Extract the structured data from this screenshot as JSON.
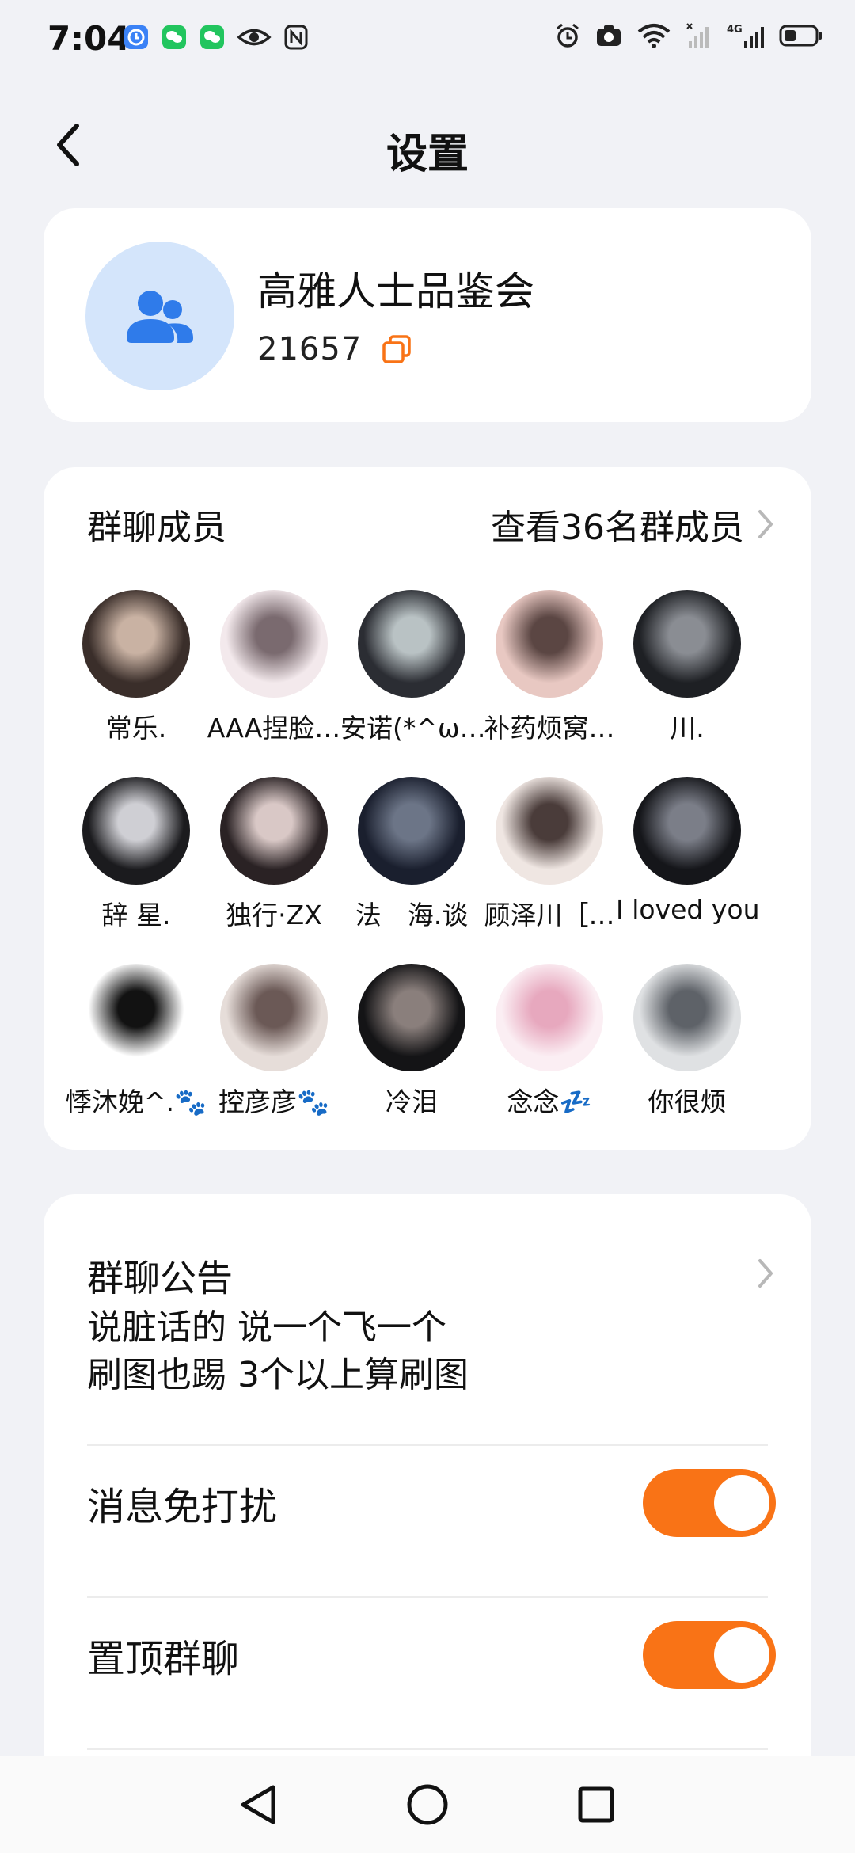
{
  "status": {
    "time": "7:04",
    "left_icons": [
      "clock-app-icon",
      "wechat-icon",
      "wechat-icon",
      "eye-icon",
      "nfc-icon"
    ],
    "right_icons": [
      "alarm-icon",
      "camera-icon",
      "wifi-icon",
      "signal-icon",
      "4g-signal-icon",
      "battery-icon"
    ],
    "network": "4G"
  },
  "header": {
    "title": "设置"
  },
  "group": {
    "name": "高雅人士品鉴会",
    "id": "21657"
  },
  "members": {
    "title": "群聊成员",
    "view_all": "查看36名群成员",
    "list": [
      {
        "name": "常乐.",
        "color1": "#3a2e2a",
        "color2": "#c9b2a3"
      },
      {
        "name": "AAA捏脸…",
        "color1": "#f3e9ec",
        "color2": "#7a6a6f"
      },
      {
        "name": "安诺(*^ω…",
        "color1": "#2b2d33",
        "color2": "#b9c2c4"
      },
      {
        "name": "补药烦窝…",
        "color1": "#e8c8c2",
        "color2": "#5b4643"
      },
      {
        "name": "川.",
        "color1": "#1e2024",
        "color2": "#8a8d93"
      },
      {
        "name": "辞 星.",
        "color1": "#1b1b1e",
        "color2": "#cfcfd4"
      },
      {
        "name": "独行·ZX",
        "color1": "#2a2224",
        "color2": "#d9c8c6"
      },
      {
        "name": "法　海.谈",
        "color1": "#1a1f2e",
        "color2": "#6c7587"
      },
      {
        "name": "顾泽川［…",
        "color1": "#efe6e2",
        "color2": "#4a3c3a"
      },
      {
        "name": "I loved you",
        "color1": "#15161a",
        "color2": "#7b7e88"
      },
      {
        "name": "悸沐娩^.🐾",
        "color1": "#ffffff",
        "color2": "#121212"
      },
      {
        "name": "控彦彦🐾",
        "color1": "#e6ddd9",
        "color2": "#6b5956"
      },
      {
        "name": "冷泪",
        "color1": "#141416",
        "color2": "#8a7f7c"
      },
      {
        "name": "念念💤",
        "color1": "#fbeef3",
        "color2": "#e7a8be"
      },
      {
        "name": "你很烦",
        "color1": "#dfe1e3",
        "color2": "#5e6268"
      }
    ]
  },
  "notice": {
    "title": "群聊公告",
    "lines": [
      "说脏话的 说一个飞一个",
      "刷图也踢 3个以上算刷图"
    ]
  },
  "settings": [
    {
      "label": "消息免打扰",
      "on": true
    },
    {
      "label": "置顶群聊",
      "on": true
    }
  ],
  "colors": {
    "accent": "#f97316",
    "background": "#f1f2f6",
    "card": "#ffffff",
    "group_avatar_bg": "#d4e5fb",
    "group_avatar_icon": "#2f7bea"
  },
  "nav": {
    "icons": [
      "back-triangle-icon",
      "home-circle-icon",
      "recents-square-icon"
    ]
  }
}
